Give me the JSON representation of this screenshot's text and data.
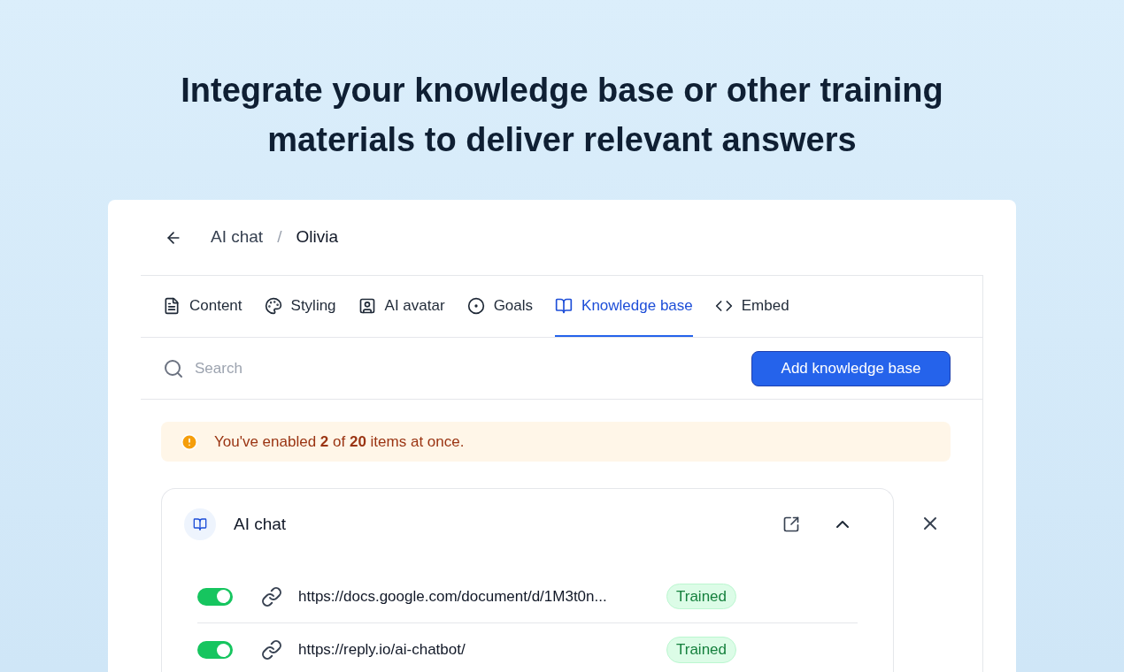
{
  "headline": "Integrate your knowledge base or other training materials to deliver relevant answers",
  "breadcrumb": {
    "parent": "AI chat",
    "separator": "/",
    "current": "Olivia"
  },
  "tabs": [
    {
      "label": "Content",
      "kind": "content",
      "selected": false
    },
    {
      "label": "Styling",
      "kind": "styling",
      "selected": false
    },
    {
      "label": "AI avatar",
      "kind": "avatar",
      "selected": false
    },
    {
      "label": "Goals",
      "kind": "goals",
      "selected": false
    },
    {
      "label": "Knowledge base",
      "kind": "knowledge",
      "selected": true
    },
    {
      "label": "Embed",
      "kind": "embed",
      "selected": false
    }
  ],
  "search": {
    "placeholder": "Search"
  },
  "add_button": "Add knowledge base",
  "alert": "You've enabled **2** of **20** items at once.",
  "source": {
    "title": "AI chat",
    "expanded": true,
    "items": [
      {
        "url": "https://docs.google.com/document/d/1M3t0n...",
        "on": true,
        "status": "Trained"
      },
      {
        "url": "https://reply.io/ai-chatbot/",
        "on": true,
        "status": "Trained"
      }
    ]
  }
}
